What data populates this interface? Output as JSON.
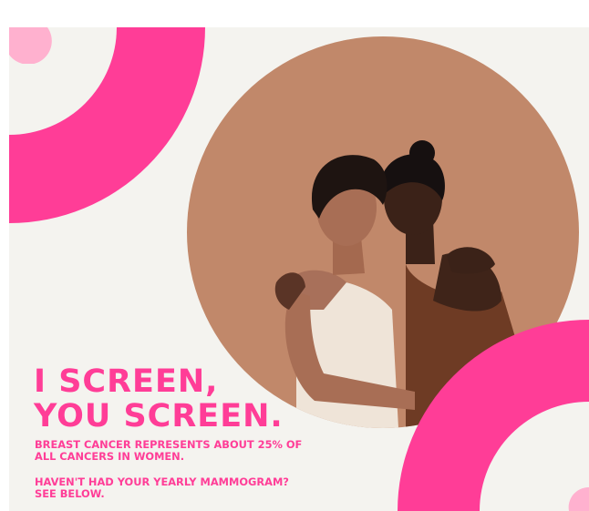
{
  "poster": {
    "headline_lines": [
      "I SCREEN,",
      "YOU SCREEN."
    ],
    "stat_lines": [
      "BREAST CANCER REPRESENTS ABOUT 25% OF",
      "ALL CANCERS IN WOMEN."
    ],
    "cta_lines": [
      "HAVEN'T HAD YOUR YEARLY MAMMOGRAM?",
      "SEE BELOW."
    ]
  },
  "colors": {
    "accent_pink": "#ff3d97",
    "light_pink": "#ffb1cf",
    "background": "#f4f3ef",
    "photo_backdrop": "#c1886a"
  },
  "icons": [
    "pink-ring-arc",
    "light-pink-dot"
  ]
}
